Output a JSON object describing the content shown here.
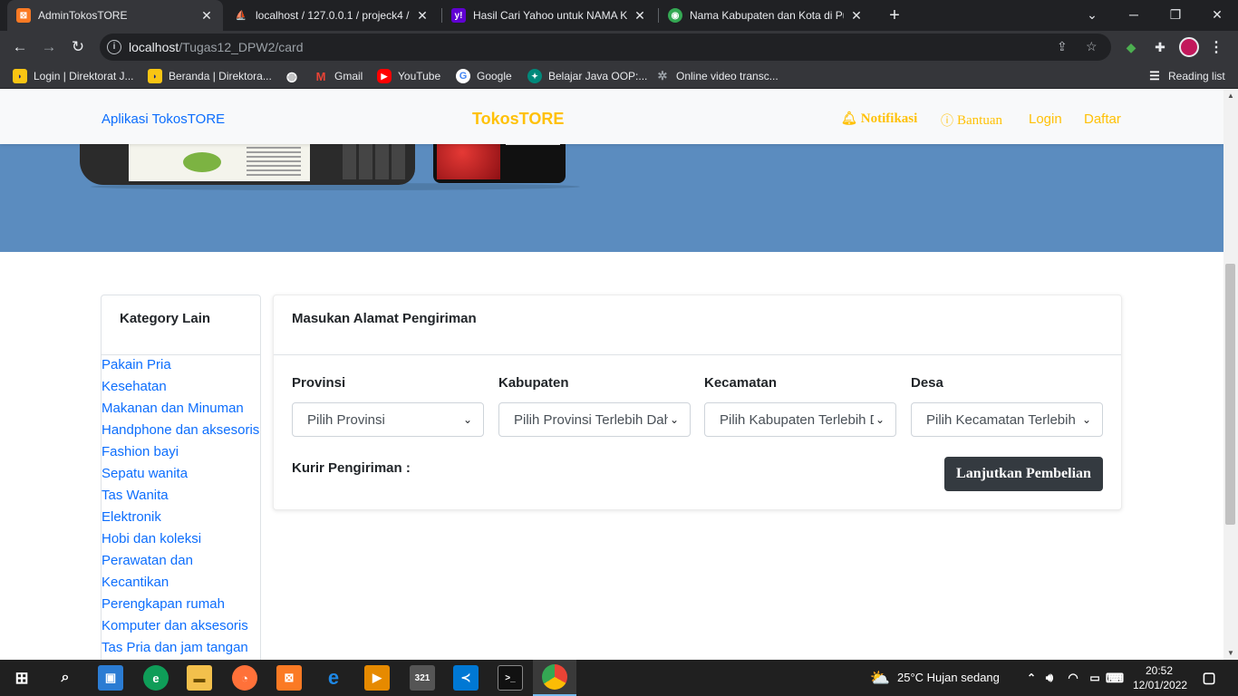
{
  "browser": {
    "tabs": [
      {
        "title": "AdminTokosTORE",
        "active": true,
        "icon": "xampp-icon",
        "color": "#fb7a24"
      },
      {
        "title": "localhost / 127.0.0.1 / projeck4 / ",
        "active": false,
        "icon": "phpmyadmin-icon",
        "color": "#f29111"
      },
      {
        "title": "Hasil Cari Yahoo untuk NAMA KA",
        "active": false,
        "icon": "yahoo-icon",
        "color": "#6001d2"
      },
      {
        "title": "Nama Kabupaten dan Kota di Pul",
        "active": false,
        "icon": "globe-icon",
        "color": "#34a853"
      }
    ],
    "url_host": "localhost",
    "url_path": "/Tugas12_DPW2/card",
    "bookmarks": [
      {
        "label": "Login | Direktorat J...",
        "icon": "direktorat-icon"
      },
      {
        "label": "Beranda | Direktora...",
        "icon": "direktorat-icon"
      },
      {
        "label": "",
        "icon": "globe-icon"
      },
      {
        "label": "Gmail",
        "icon": "gmail-icon"
      },
      {
        "label": "YouTube",
        "icon": "youtube-icon"
      },
      {
        "label": "Google",
        "icon": "google-icon"
      },
      {
        "label": "Belajar Java OOP:...",
        "icon": "java-icon"
      },
      {
        "label": "Online video transc...",
        "icon": "gear-icon"
      }
    ],
    "reading_list": "Reading list"
  },
  "site": {
    "brand_left": "Aplikasi TokosTORE",
    "brand_center": "TokosTORE",
    "nav": {
      "notifikasi": "Notifikasi",
      "bantuan": "Bantuan",
      "login": "Login",
      "daftar": "Daftar"
    },
    "colors": {
      "primary": "#0d6efd",
      "warning": "#ffc107",
      "dark": "#343a40",
      "hero": "#5b8cbf"
    }
  },
  "sidebar": {
    "title": "Kategory Lain",
    "items": [
      "Pakain Pria",
      "Kesehatan",
      "Makanan dan Minuman",
      "Handphone dan aksesoris",
      "Fashion bayi",
      "Sepatu wanita",
      "Tas Wanita",
      "Elektronik",
      "Hobi dan koleksi",
      "Perawatan dan",
      "Kecantikan",
      "Perengkapan rumah",
      "Komputer dan aksesoris",
      "Tas Pria dan jam tangan"
    ]
  },
  "shipping": {
    "title": "Masukan Alamat Pengiriman",
    "fields": [
      {
        "label": "Provinsi",
        "value": "Pilih Provinsi"
      },
      {
        "label": "Kabupaten",
        "value": "Pilih Provinsi Terlebih Dahulu"
      },
      {
        "label": "Kecamatan",
        "value": "Pilih Kabupaten Terlebih Dahulu"
      },
      {
        "label": "Desa",
        "value": "Pilih Kecamatan Terlebih Dahulu"
      }
    ],
    "kurir_label": "Kurir Pengiriman :",
    "submit_label": "Lanjutkan Pembelian"
  },
  "taskbar": {
    "weather": "25°C  Hujan sedang",
    "time": "20:52",
    "date": "12/01/2022"
  }
}
